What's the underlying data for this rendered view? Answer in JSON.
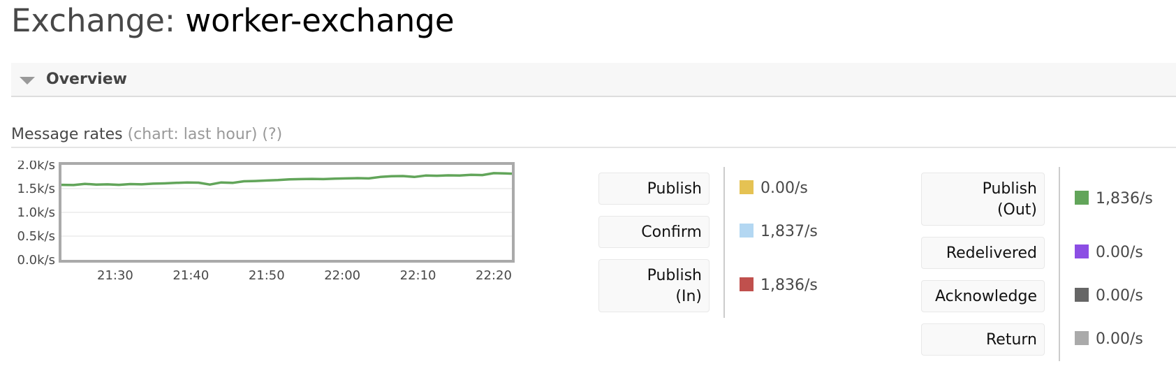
{
  "page": {
    "title_prefix": "Exchange:",
    "title_name": "worker-exchange"
  },
  "section": {
    "label": "Overview",
    "expanded": true
  },
  "subheading": {
    "label": "Message rates",
    "chart_note": "(chart: last hour)",
    "help": "(?)"
  },
  "legend": {
    "left": [
      {
        "label": "Publish",
        "value": "0.00/s",
        "color": "#e5c253"
      },
      {
        "label": "Confirm",
        "value": "1,837/s",
        "color": "#b3d7f2"
      },
      {
        "label": "Publish\n(In)",
        "value": "1,836/s",
        "color": "#c0504d"
      }
    ],
    "right": [
      {
        "label": "Publish\n(Out)",
        "value": "1,836/s",
        "color": "#62a55a"
      },
      {
        "label": "Redelivered",
        "value": "0.00/s",
        "color": "#8c4ee4"
      },
      {
        "label": "Acknowledge",
        "value": "0.00/s",
        "color": "#666666"
      },
      {
        "label": "Return",
        "value": "0.00/s",
        "color": "#aaaaaa"
      }
    ]
  },
  "chart_data": {
    "type": "line",
    "title": "Message rates (chart: last hour)",
    "xlabel": "",
    "ylabel": "",
    "ylim": [
      0,
      2000
    ],
    "xlim": [
      "21:22:54",
      "22:22:24"
    ],
    "yticks": [
      "0.0k/s",
      "0.5k/s",
      "1.0k/s",
      "1.5k/s",
      "2.0k/s"
    ],
    "ytick_values": [
      0,
      500,
      1000,
      1500,
      2000
    ],
    "xticks": [
      "21:30",
      "21:40",
      "21:50",
      "22:00",
      "22:10",
      "22:20"
    ],
    "xtick_minutes": [
      30,
      40,
      50,
      60,
      70,
      80
    ],
    "grid": true,
    "legend": "right",
    "series": [
      {
        "name": "Publish (Out)",
        "color": "#62a55a",
        "x_minutes": [
          22.9,
          24.5,
          26.0,
          27.5,
          29.0,
          30.5,
          32.0,
          33.5,
          35.0,
          36.5,
          38.0,
          39.5,
          41.0,
          42.5,
          44.0,
          45.5,
          47.0,
          48.5,
          50.0,
          51.5,
          53.0,
          54.5,
          56.0,
          57.5,
          59.0,
          60.5,
          62.0,
          63.5,
          65.0,
          66.5,
          68.0,
          69.5,
          71.0,
          72.5,
          74.0,
          75.5,
          77.0,
          78.5,
          80.0,
          81.5,
          82.4
        ],
        "values": [
          1580,
          1575,
          1600,
          1585,
          1590,
          1580,
          1595,
          1590,
          1605,
          1610,
          1620,
          1630,
          1625,
          1585,
          1630,
          1620,
          1655,
          1660,
          1670,
          1680,
          1695,
          1700,
          1705,
          1700,
          1710,
          1715,
          1720,
          1715,
          1745,
          1760,
          1765,
          1745,
          1775,
          1770,
          1780,
          1775,
          1790,
          1785,
          1825,
          1820,
          1815
        ]
      }
    ]
  }
}
